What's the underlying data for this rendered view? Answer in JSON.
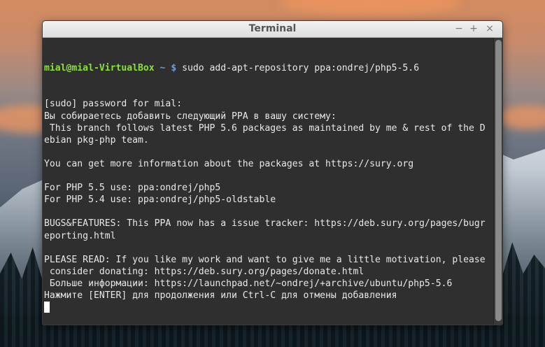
{
  "window": {
    "title": "Terminal",
    "controls": {
      "minimize": "−",
      "maximize": "+",
      "close": "×"
    }
  },
  "terminal": {
    "prompt_user": "mial@mial-VirtualBox",
    "prompt_path": " ~ $",
    "command": " sudo add-apt-repository ppa:ondrej/php5-5.6",
    "lines": [
      "[sudo] password for mial:",
      "Вы собираетесь добавить следующий PPA в вашу систему:",
      " This branch follows latest PHP 5.6 packages as maintained by me & rest of the D",
      "ebian pkg-php team.",
      "",
      "You can get more information about the packages at https://sury.org",
      "",
      "For PHP 5.5 use: ppa:ondrej/php5",
      "For PHP 5.4 use: ppa:ondrej/php5-oldstable",
      "",
      "BUGS&FEATURES: This PPA now has a issue tracker: https://deb.sury.org/pages/bugr",
      "eporting.html",
      "",
      "PLEASE READ: If you like my work and want to give me a little motivation, please",
      " consider donating: https://deb.sury.org/pages/donate.html",
      " Больше информации: https://launchpad.net/~ondrej/+archive/ubuntu/php5-5.6",
      "Нажмите [ENTER] для продолжения или Ctrl-C для отмены добавления"
    ]
  },
  "colors": {
    "terminal_bg": "#2f2f2f",
    "prompt_user": "#8ae234",
    "prompt_path": "#729fcf",
    "text": "#e8e8e8"
  }
}
